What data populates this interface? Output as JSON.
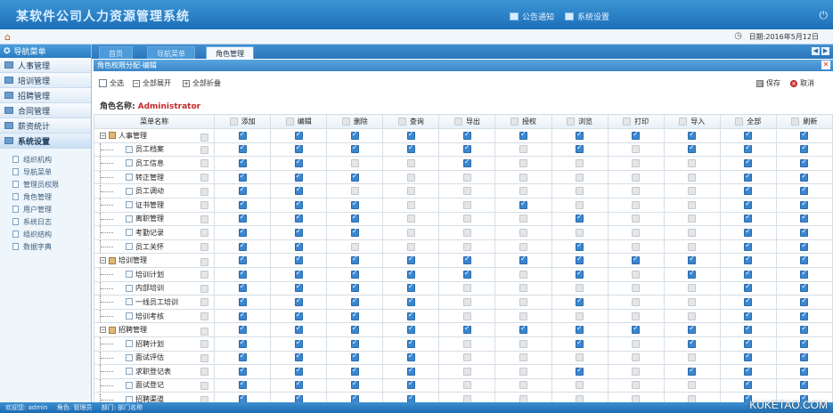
{
  "header": {
    "title": "某软件公司人力资源管理系统",
    "links": [
      "公告通知",
      "系统设置"
    ]
  },
  "subbar": {
    "date": "日期:2016年5月12日"
  },
  "sidebar": {
    "title": "导航菜单",
    "groups": [
      "人事管理",
      "培训管理",
      "招聘管理",
      "合同管理",
      "薪资统计",
      "系统设置"
    ],
    "sub_items": [
      "组织机构",
      "导航菜单",
      "管理员权限",
      "角色管理",
      "用户管理",
      "系统日志",
      "组织结构",
      "数据字典"
    ]
  },
  "tabs": [
    "首页",
    "导航菜单",
    "角色管理"
  ],
  "panel": {
    "title": "角色权限分配-编辑"
  },
  "toolbar": {
    "select_all": "全选",
    "expand_all": "全部展开",
    "collapse_all": "全部折叠",
    "save": "保存",
    "cancel": "取消"
  },
  "role": {
    "label": "角色名称:",
    "value": "Administrator"
  },
  "table": {
    "menu_header": "菜单名称",
    "columns": [
      "添加",
      "编辑",
      "删除",
      "查询",
      "导出",
      "授权",
      "浏览",
      "打印",
      "导入",
      "全部",
      "刷新"
    ],
    "rows": [
      {
        "name": "人事管理",
        "level": 0,
        "checks": [
          1,
          1,
          1,
          1,
          1,
          1,
          1,
          1,
          1,
          1,
          1
        ]
      },
      {
        "name": "员工档案",
        "level": 1,
        "checks": [
          1,
          1,
          1,
          1,
          1,
          0,
          1,
          0,
          1,
          1,
          1
        ]
      },
      {
        "name": "员工信息",
        "level": 1,
        "checks": [
          1,
          1,
          0,
          0,
          1,
          0,
          0,
          0,
          0,
          1,
          1
        ]
      },
      {
        "name": "转正管理",
        "level": 1,
        "checks": [
          1,
          1,
          1,
          0,
          0,
          0,
          0,
          0,
          0,
          1,
          1
        ]
      },
      {
        "name": "员工调动",
        "level": 1,
        "checks": [
          1,
          1,
          0,
          0,
          0,
          0,
          0,
          0,
          0,
          1,
          1
        ]
      },
      {
        "name": "证书管理",
        "level": 1,
        "checks": [
          1,
          1,
          1,
          0,
          0,
          1,
          0,
          0,
          0,
          1,
          1
        ]
      },
      {
        "name": "离职管理",
        "level": 1,
        "checks": [
          1,
          1,
          1,
          0,
          0,
          0,
          1,
          0,
          0,
          1,
          1
        ]
      },
      {
        "name": "考勤记录",
        "level": 1,
        "checks": [
          1,
          1,
          1,
          0,
          0,
          0,
          0,
          0,
          0,
          1,
          1
        ]
      },
      {
        "name": "员工关怀",
        "level": 1,
        "checks": [
          1,
          1,
          0,
          0,
          0,
          0,
          1,
          0,
          0,
          1,
          1
        ]
      },
      {
        "name": "培训管理",
        "level": 0,
        "checks": [
          1,
          1,
          1,
          1,
          1,
          1,
          1,
          1,
          1,
          1,
          1
        ]
      },
      {
        "name": "培训计划",
        "level": 1,
        "checks": [
          1,
          1,
          1,
          1,
          1,
          0,
          1,
          0,
          1,
          1,
          1
        ]
      },
      {
        "name": "内部培训",
        "level": 1,
        "checks": [
          1,
          1,
          1,
          1,
          0,
          0,
          0,
          0,
          0,
          1,
          1
        ]
      },
      {
        "name": "一线员工培训",
        "level": 1,
        "checks": [
          1,
          1,
          1,
          1,
          0,
          0,
          1,
          0,
          0,
          1,
          1
        ]
      },
      {
        "name": "培训考核",
        "level": 1,
        "checks": [
          1,
          1,
          1,
          1,
          0,
          0,
          0,
          0,
          0,
          1,
          1
        ]
      },
      {
        "name": "招聘管理",
        "level": 0,
        "checks": [
          1,
          1,
          1,
          1,
          1,
          1,
          1,
          1,
          1,
          1,
          1
        ]
      },
      {
        "name": "招聘计划",
        "level": 1,
        "checks": [
          1,
          1,
          1,
          1,
          0,
          0,
          1,
          0,
          1,
          1,
          1
        ]
      },
      {
        "name": "面试评估",
        "level": 1,
        "checks": [
          1,
          1,
          1,
          1,
          0,
          0,
          0,
          0,
          0,
          1,
          1
        ]
      },
      {
        "name": "求职登记表",
        "level": 1,
        "checks": [
          1,
          1,
          1,
          1,
          0,
          0,
          1,
          0,
          1,
          1,
          1
        ]
      },
      {
        "name": "面试登记",
        "level": 1,
        "checks": [
          1,
          1,
          1,
          1,
          0,
          0,
          0,
          0,
          0,
          1,
          1
        ]
      },
      {
        "name": "招聘渠道",
        "level": 1,
        "checks": [
          1,
          1,
          1,
          1,
          0,
          0,
          0,
          0,
          0,
          1,
          1
        ]
      }
    ]
  },
  "footer": {
    "items": [
      "欢迎您: admin",
      "角色: 管理员",
      "部门: 部门名称"
    ]
  },
  "watermark": "KUKETAO.COM",
  "colors": {
    "header": "#2a80c6",
    "checked": "#3a86d1",
    "role_value": "#c62828"
  }
}
